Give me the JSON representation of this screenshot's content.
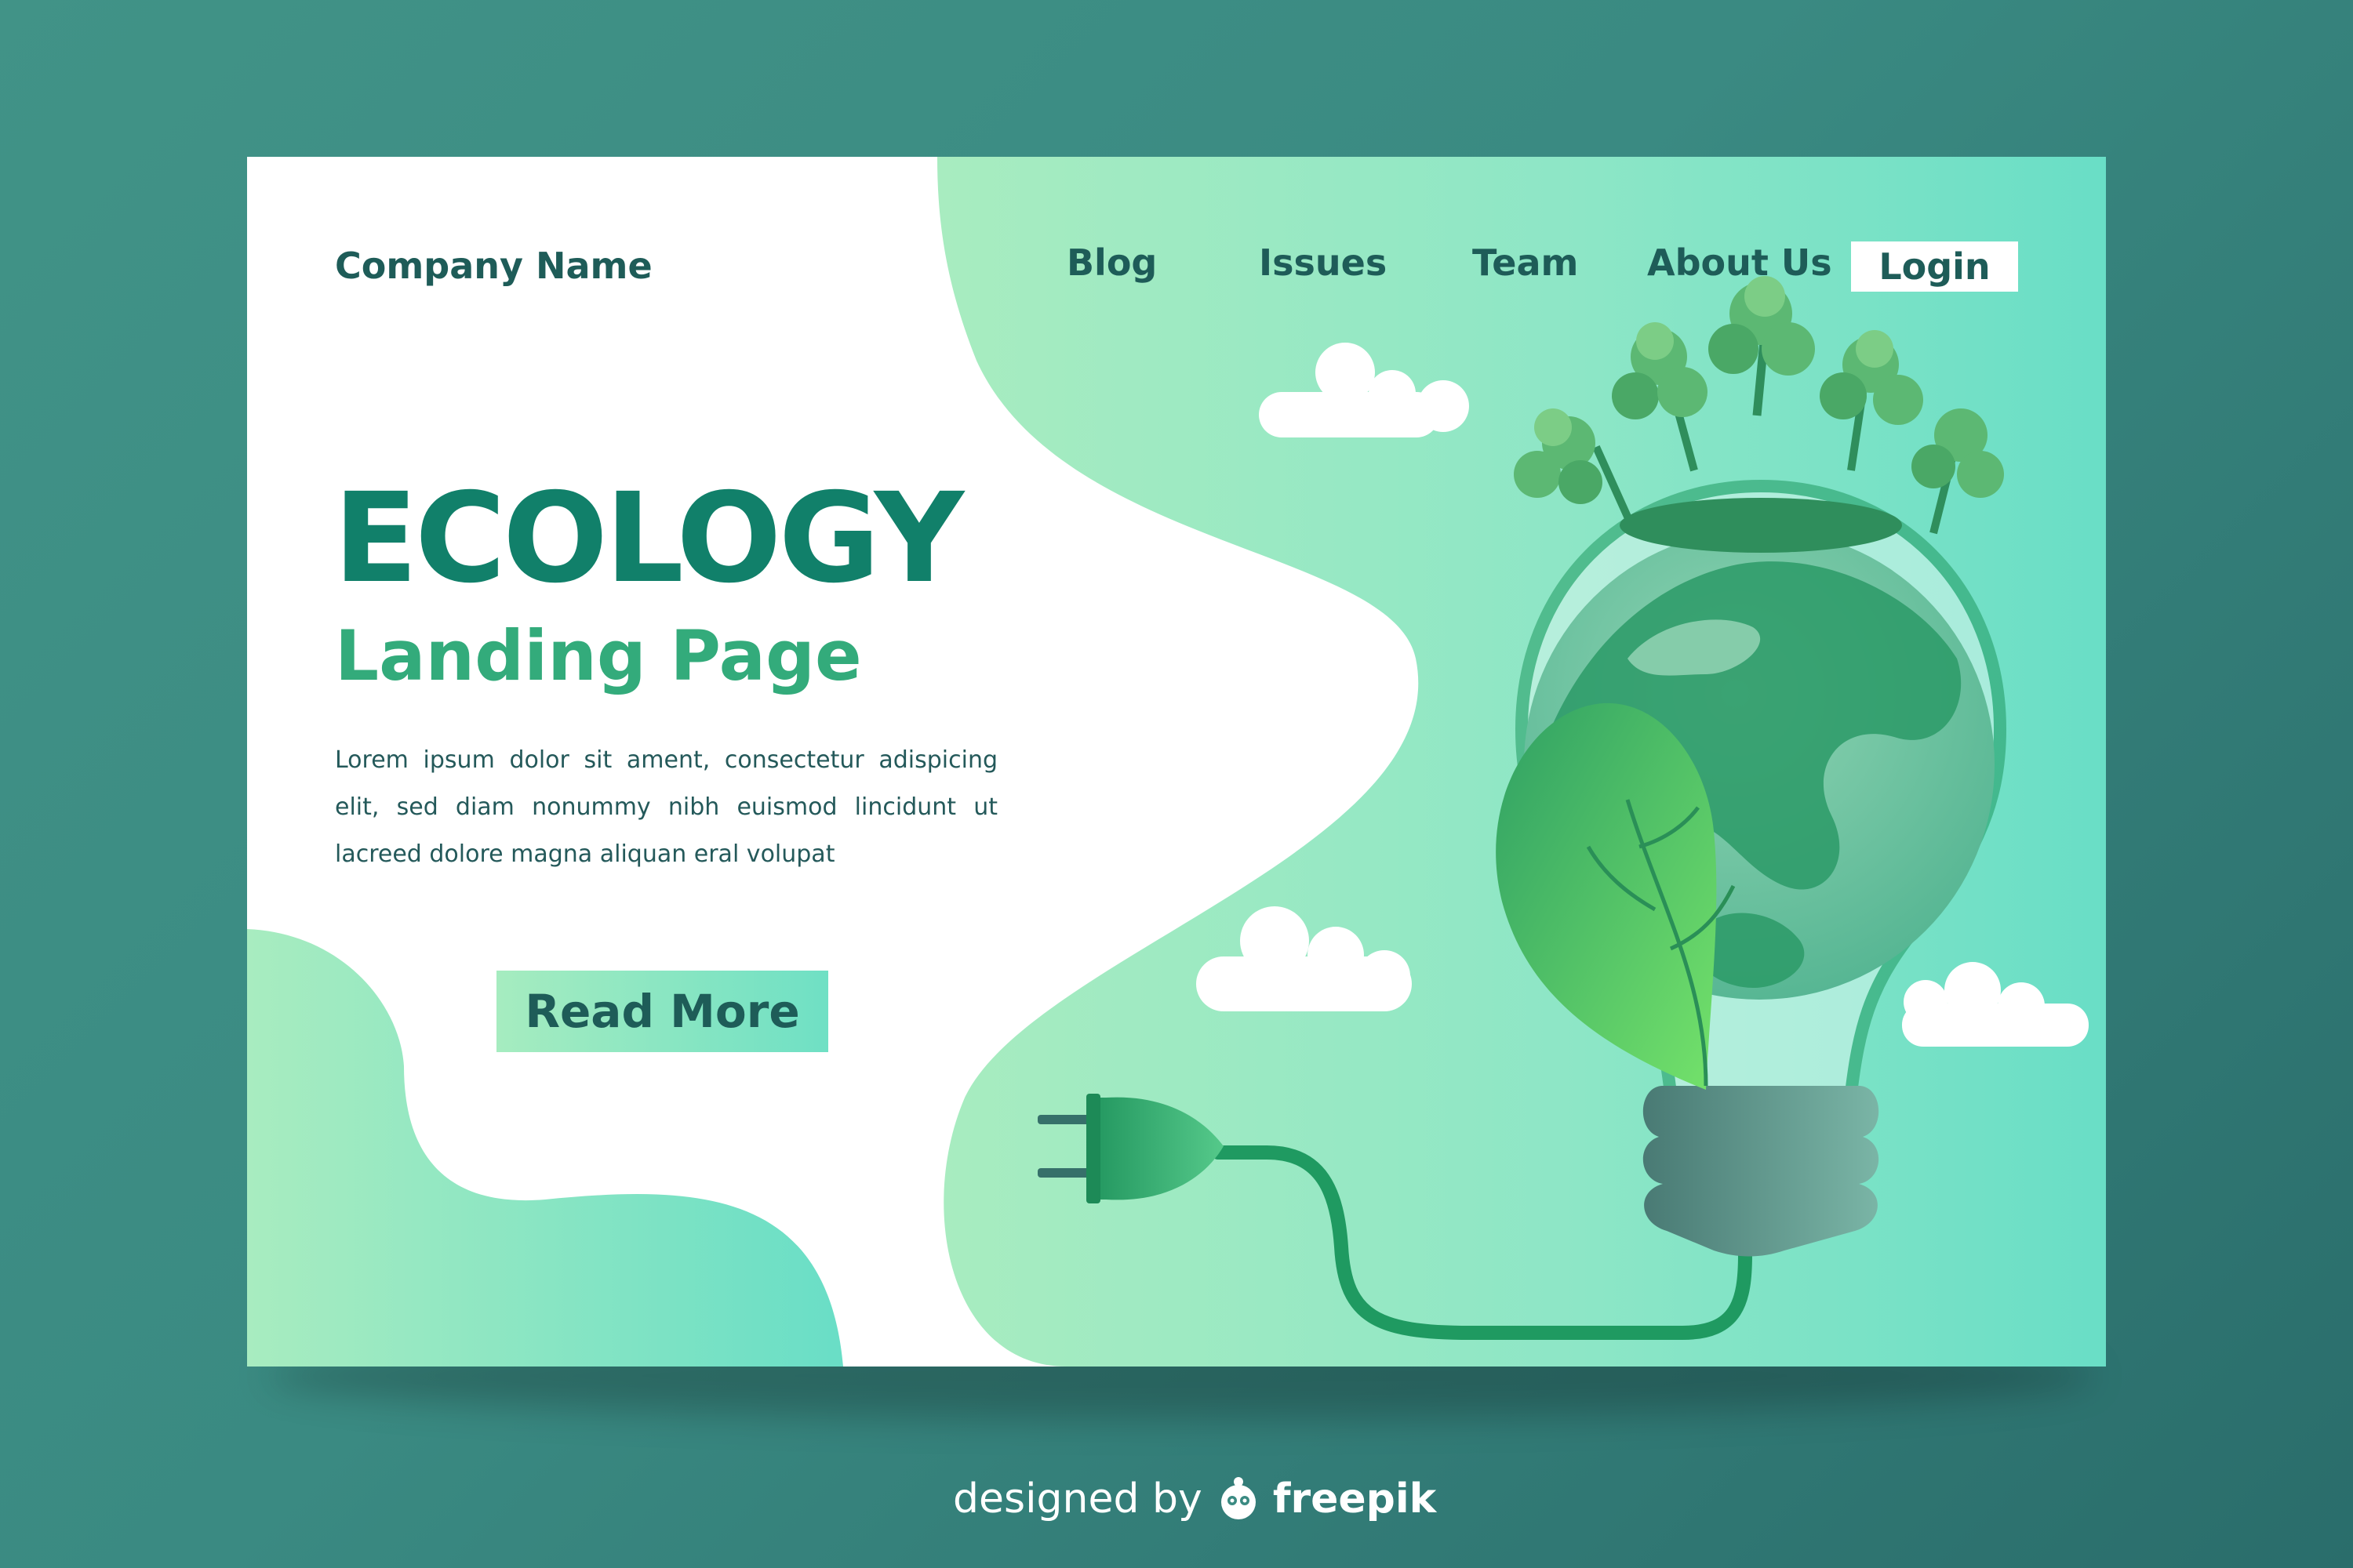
{
  "header": {
    "brand": "Company Name",
    "nav": [
      "Blog",
      "Issues",
      "Team",
      "About Us"
    ],
    "login_label": "Login"
  },
  "hero": {
    "title": "ECOLOGY",
    "subtitle": "Landing Page",
    "body": "Lorem ipsum dolor sit ament, consectetur adispicing elit, sed diam nonummy nibh euismod lincidunt ut lacreed dolore magna aliquan eral volupat",
    "cta_label": "Read More"
  },
  "footer": {
    "credit_prefix": "designed by",
    "credit_brand": "freepik"
  },
  "colors": {
    "background": "#3a8a82",
    "card": "#ffffff",
    "title": "#11806a",
    "subtitle": "#33ab7b",
    "text": "#1e5c58",
    "mint_light": "#a6ecc0",
    "mint_dark": "#6fe0c4",
    "cord": "#1f9a61"
  },
  "icons": {
    "illustration": "lightbulb-earth-illustration",
    "plug": "plug-icon",
    "leaf": "leaf-icon",
    "tree": "tree-icon",
    "cloud": "cloud-icon",
    "logo": "freepik-logo-icon"
  }
}
